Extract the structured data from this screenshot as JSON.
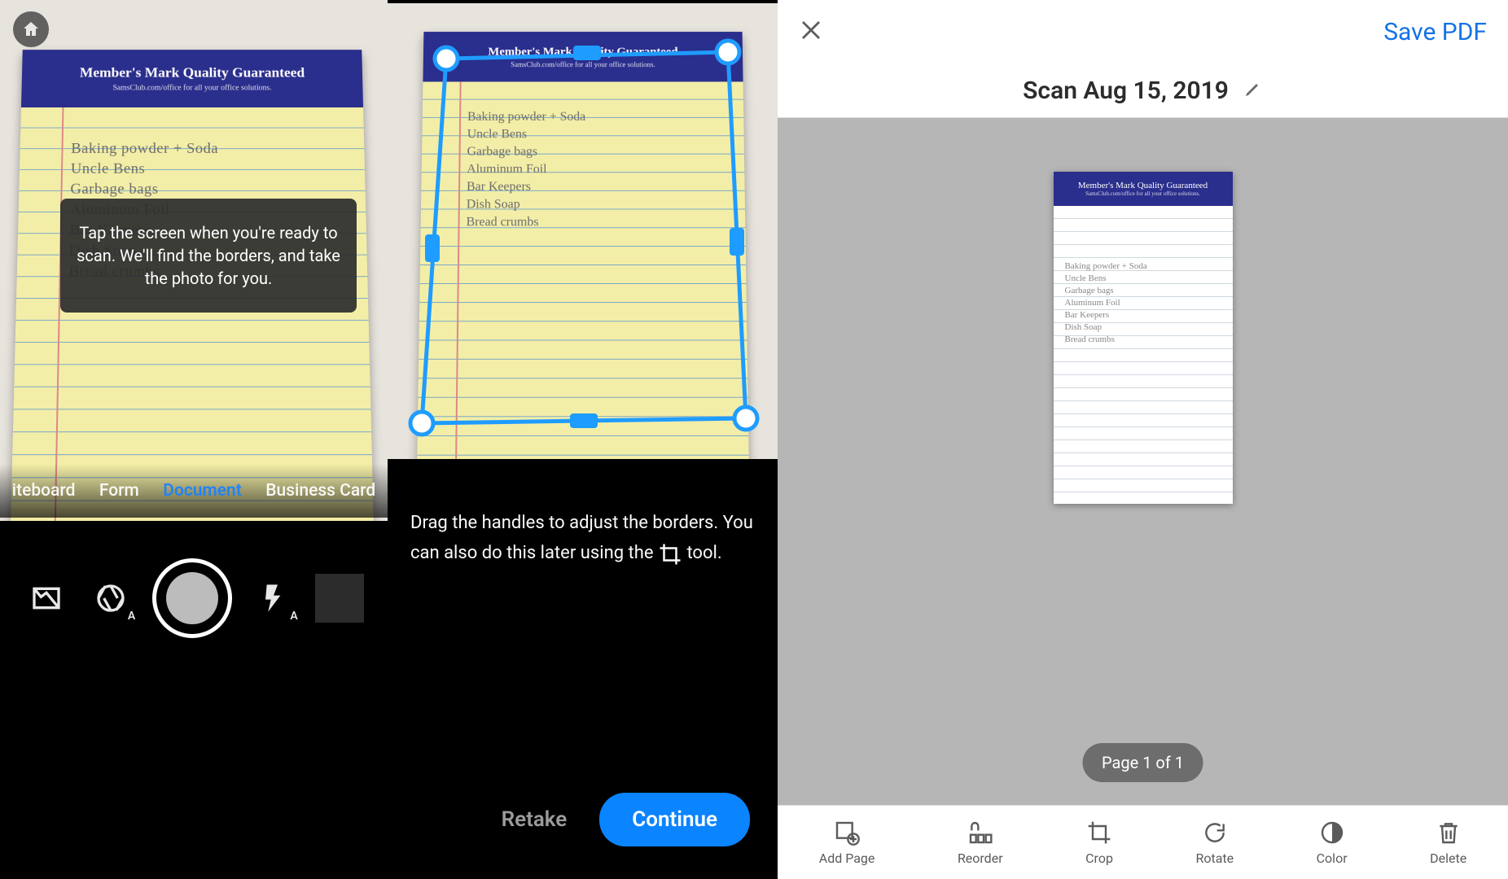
{
  "notepad": {
    "header_title": "Member's Mark Quality Guaranteed",
    "header_sub": "SamsClub.com/office for all your office solutions.",
    "lines": [
      "Baking powder + Soda",
      "Uncle Bens",
      "Garbage bags",
      "Aluminum Foil",
      "Bar Keepers",
      "Dish Soap",
      "Bread crumbs"
    ]
  },
  "panel1": {
    "tooltip": "Tap the screen when you're ready to scan. We'll find the borders, and take the photo for you.",
    "tabs": [
      "iteboard",
      "Form",
      "Document",
      "Business Card"
    ],
    "active_tab_index": 2
  },
  "panel2": {
    "instruction_pre": "Drag the handles to adjust the borders. You can also do this later using the ",
    "instruction_post": " tool.",
    "retake_label": "Retake",
    "continue_label": "Continue"
  },
  "panel3": {
    "save_label": "Save PDF",
    "scan_title": "Scan Aug 15, 2019",
    "page_indicator": "Page 1 of 1",
    "tools": [
      "Add Page",
      "Reorder",
      "Crop",
      "Rotate",
      "Color",
      "Delete"
    ]
  }
}
